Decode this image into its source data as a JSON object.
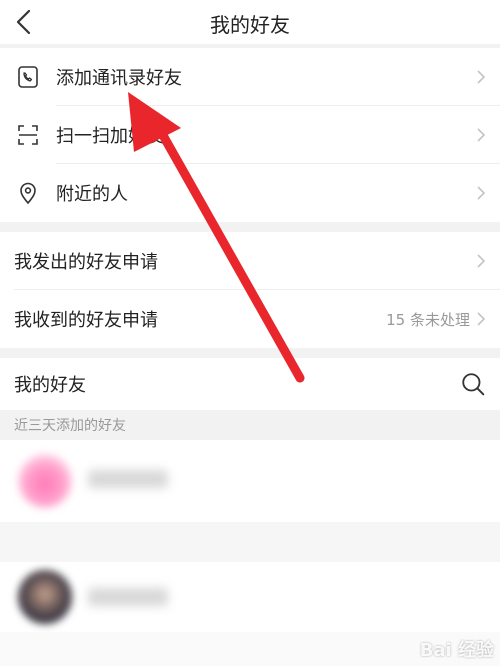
{
  "header": {
    "title": "我的好友"
  },
  "menu_top": [
    {
      "label": "添加通讯录好友",
      "icon": "phone-book-icon"
    },
    {
      "label": "扫一扫加好友",
      "icon": "scan-icon"
    },
    {
      "label": "附近的人",
      "icon": "location-pin-icon"
    }
  ],
  "requests": {
    "sent_label": "我发出的好友申请",
    "received_label": "我收到的好友申请",
    "received_pending": "15 条未处理"
  },
  "friends": {
    "title": "我的好友",
    "recent_section": "近三天添加的好友",
    "search_icon": "search-icon"
  },
  "watermark": "Bai 经验",
  "colors": {
    "annotation_arrow": "#e8262b"
  }
}
